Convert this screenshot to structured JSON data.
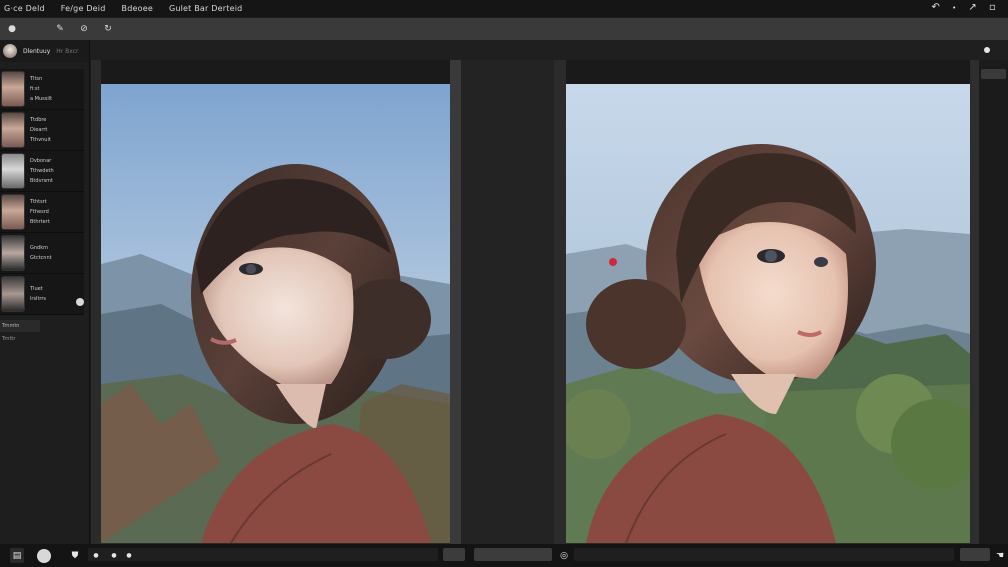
{
  "menubar": {
    "items": [
      "G·ce Deld",
      "Fe/ge Deid",
      "Bdeoee",
      "Gulet Bar Derteid"
    ],
    "right_icons": [
      "undo-arrow-icon",
      "dot-icon",
      "pin-icon",
      "window-icon"
    ]
  },
  "toolbar": {
    "icons": [
      "dot-icon",
      "pencil-icon",
      "tool-icon-2",
      "rotate-icon"
    ]
  },
  "left_panel": {
    "header_title": "Dlentuuy",
    "header_sub": "Hr Bxcr",
    "layers": [
      {
        "lines": [
          "Tltsn",
          "fi:st",
          "a Mussilt"
        ]
      },
      {
        "lines": [
          "Ttdbre",
          "Diearrt",
          "Tthvnuit"
        ]
      },
      {
        "lines": [
          "Dvbonar",
          "Tthwdeth",
          "Btdvrsmt"
        ]
      },
      {
        "lines": [
          "Tthtsrt",
          "Fthesrd",
          "Bthrtert"
        ]
      },
      {
        "lines": [
          "Gndkm",
          "Gtctcnnt"
        ]
      },
      {
        "lines": [
          "Tluet",
          "lrsltrrs"
        ]
      }
    ],
    "footer": "Trnmtn",
    "footer2": "Trnttr"
  },
  "bottombar": {
    "icons": [
      "layers-icon",
      "circle-icon",
      "adjust-icon",
      "dot-icon",
      "dot-icon",
      "dot-icon",
      "sync-icon",
      "hand-icon"
    ]
  },
  "colors": {
    "menubar": "#151515",
    "toolbar": "#3a3a3a",
    "workspace": "#232323"
  }
}
